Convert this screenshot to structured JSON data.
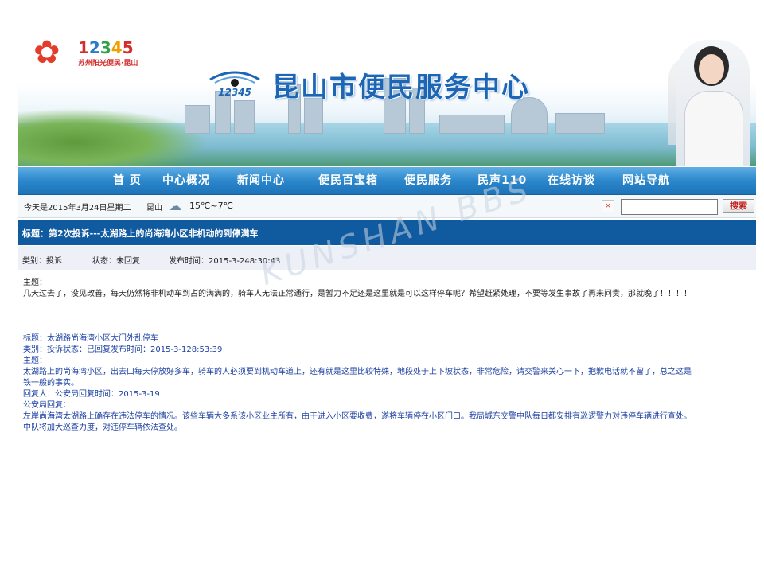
{
  "header": {
    "logo_number": [
      "1",
      "2",
      "3",
      "4",
      "5"
    ],
    "logo_sub": "苏州阳光便民·昆山",
    "center_logo_text": "12345",
    "site_title": "昆山市便民服务中心",
    "flower_icon": "flower-icon"
  },
  "nav": {
    "items": [
      {
        "label": "首  页"
      },
      {
        "label": "中心概况"
      },
      {
        "label": "新闻中心"
      },
      {
        "label": "便民百宝箱"
      },
      {
        "label": "便民服务"
      },
      {
        "label": "民声110"
      },
      {
        "label": "在线访谈"
      },
      {
        "label": "网站导航"
      }
    ]
  },
  "infobar": {
    "date": "今天是2015年3月24日星期二",
    "city": "昆山",
    "weather_icon": "cloudy-icon",
    "temperature": "15℃~7℃",
    "search_placeholder": "",
    "search_button": "搜索"
  },
  "post": {
    "title": "标题：第2次投诉---太湖路上的尚海湾小区非机动的到停满车",
    "category": "类别：投诉",
    "status": "状态：未回复",
    "published": "发布时间：2015-3-248:30:43",
    "theme_label": "主题：",
    "body": "几天过去了，没见改善，每天仍然将非机动车到占的满满的，骑车人无法正常通行，是暂力不足还是这里就是可以这样停车呢？希望赶紧处理，不要等发生事故了再来问责，那就晚了！！！！"
  },
  "related": {
    "title": "标题：太湖路尚海湾小区大门外乱停车",
    "meta": "类别：投诉状态：已回复发布时间：2015-3-128:53:39",
    "theme_label": "主题：",
    "body_line1": "太湖路上的尚海湾小区，出去口每天停放好多车，骑车的人必须要到机动车道上，还有就是这里比较特殊，地段处于上下坡状态，非常危险，请交警来关心一下，抱歉电话就不留了，总之这是",
    "body_line2": "铁一般的事实。",
    "reply_by": "回复人：公安局回复时间：2015-3-19",
    "reply_label": "公安局回复：",
    "reply_line1": "左岸尚海湾太湖路上确存在违法停车的情况。该些车辆大多系该小区业主所有，由于进入小区要收费，遂将车辆停在小区门口。我局城东交警中队每日都安排有巡逻警力对违停车辆进行查处。",
    "reply_line2": "中队将加大巡查力度，对违停车辆依法查处。"
  },
  "watermark": "KUNSHAN BBS",
  "colors": {
    "nav_blue": "#2b87cc",
    "title_bar": "#105aa0",
    "site_title": "#1d66b5",
    "search_btn_text": "#c21e1e"
  }
}
